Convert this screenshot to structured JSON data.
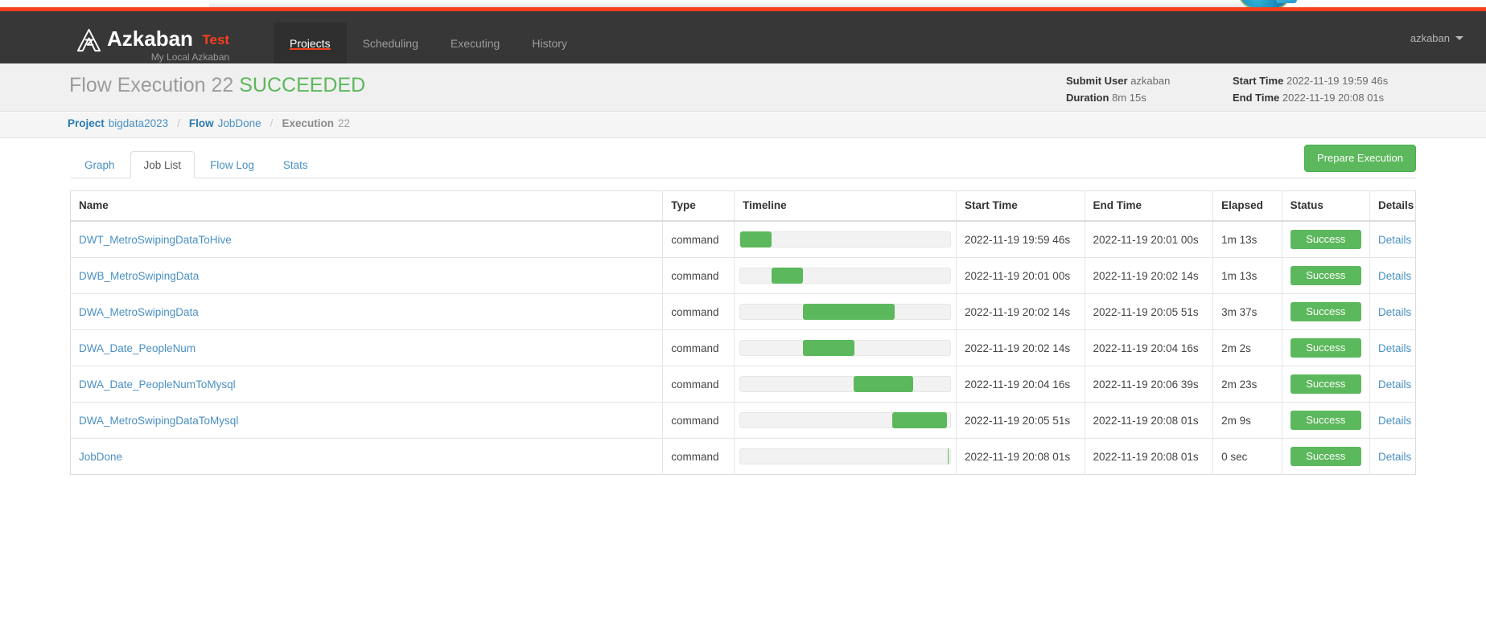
{
  "brand": {
    "logo_icon": "azkaban-logo-icon",
    "name": "Azkaban",
    "env": "Test",
    "subtitle": "My Local Azkaban"
  },
  "nav": {
    "items": [
      {
        "label": "Projects",
        "active": true
      },
      {
        "label": "Scheduling",
        "active": false
      },
      {
        "label": "Executing",
        "active": false
      },
      {
        "label": "History",
        "active": false
      }
    ],
    "user": "azkaban",
    "caret_icon": "chevron-down-icon"
  },
  "header": {
    "title_prefix": "Flow Execution 22",
    "status": "SUCCEEDED",
    "meta_left": [
      {
        "label": "Submit User",
        "value": "azkaban"
      },
      {
        "label": "Duration",
        "value": "8m 15s"
      }
    ],
    "meta_right": [
      {
        "label": "Start Time",
        "value": "2022-11-19 19:59 46s"
      },
      {
        "label": "End Time",
        "value": "2022-11-19 20:08 01s"
      }
    ]
  },
  "breadcrumb": {
    "project_label": "Project",
    "project_name": "bigdata2023",
    "flow_label": "Flow",
    "flow_name": "JobDone",
    "execution_label": "Execution",
    "execution_id": "22",
    "separator": "/"
  },
  "tabs": [
    {
      "label": "Graph",
      "active": false
    },
    {
      "label": "Job List",
      "active": true
    },
    {
      "label": "Flow Log",
      "active": false
    },
    {
      "label": "Stats",
      "active": false
    }
  ],
  "actions": {
    "prepare_execution": "Prepare Execution"
  },
  "table": {
    "columns": [
      "Name",
      "Type",
      "Timeline",
      "Start Time",
      "End Time",
      "Elapsed",
      "Status",
      "Details"
    ],
    "details_label": "Details",
    "rows": [
      {
        "name": "DWT_MetroSwipingDataToHive",
        "type": "command",
        "start": "2022-11-19 19:59 46s",
        "end": "2022-11-19 20:01 00s",
        "elapsed": "1m 13s",
        "status": "Success",
        "bar_left_pct": 0.0,
        "bar_width_pct": 15.0
      },
      {
        "name": "DWB_MetroSwipingData",
        "type": "command",
        "start": "2022-11-19 20:01 00s",
        "end": "2022-11-19 20:02 14s",
        "elapsed": "1m 13s",
        "status": "Success",
        "bar_left_pct": 15.0,
        "bar_width_pct": 15.0
      },
      {
        "name": "DWA_MetroSwipingData",
        "type": "command",
        "start": "2022-11-19 20:02 14s",
        "end": "2022-11-19 20:05 51s",
        "elapsed": "3m 37s",
        "status": "Success",
        "bar_left_pct": 30.0,
        "bar_width_pct": 43.5
      },
      {
        "name": "DWA_Date_PeopleNum",
        "type": "command",
        "start": "2022-11-19 20:02 14s",
        "end": "2022-11-19 20:04 16s",
        "elapsed": "2m 2s",
        "status": "Success",
        "bar_left_pct": 30.0,
        "bar_width_pct": 24.5
      },
      {
        "name": "DWA_Date_PeopleNumToMysql",
        "type": "command",
        "start": "2022-11-19 20:04 16s",
        "end": "2022-11-19 20:06 39s",
        "elapsed": "2m 23s",
        "status": "Success",
        "bar_left_pct": 54.0,
        "bar_width_pct": 28.5
      },
      {
        "name": "DWA_MetroSwipingDataToMysql",
        "type": "command",
        "start": "2022-11-19 20:05 51s",
        "end": "2022-11-19 20:08 01s",
        "elapsed": "2m 9s",
        "status": "Success",
        "bar_left_pct": 72.5,
        "bar_width_pct": 26.0
      },
      {
        "name": "JobDone",
        "type": "command",
        "start": "2022-11-19 20:08 01s",
        "end": "2022-11-19 20:08 01s",
        "elapsed": "0 sec",
        "status": "Success",
        "bar_left_pct": 98.7,
        "bar_width_pct": 0.7
      }
    ]
  },
  "colors": {
    "accent_orange": "#f5401d",
    "nav_dark": "#373737",
    "success_green": "#5cb85c",
    "link_blue": "#4a90c4"
  }
}
